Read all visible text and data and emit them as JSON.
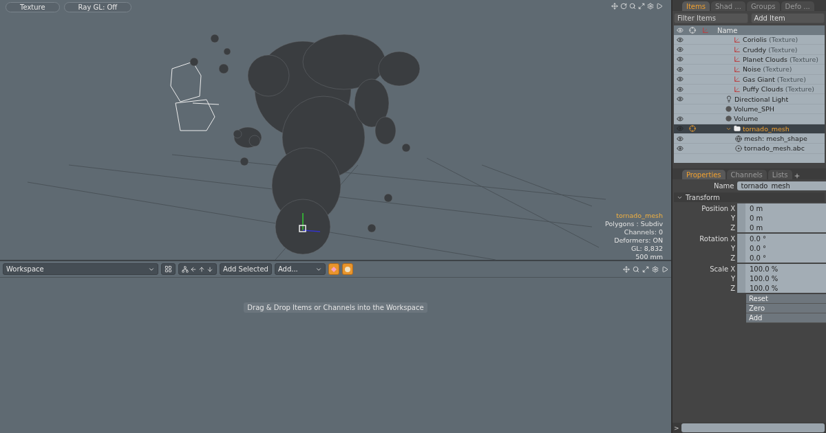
{
  "viewport": {
    "toolbar": [
      "Texture",
      "Ray GL: Off"
    ],
    "info": {
      "title": "tornado_mesh",
      "lines": [
        "Polygons : Subdiv",
        "Channels: 0",
        "Deformers: ON",
        "GL: 8,832",
        "500 mm"
      ]
    }
  },
  "workspace": {
    "dropdown": "Workspace",
    "add_selected": "Add Selected",
    "add_dropdown": "Add...",
    "hint": "Drag & Drop Items or Channels into the Workspace"
  },
  "items_panel": {
    "tabs": [
      {
        "label": "Items",
        "selected": true
      },
      {
        "label": "Shad ...",
        "selected": false
      },
      {
        "label": "Groups",
        "selected": false
      },
      {
        "label": "Defo ...",
        "selected": false
      }
    ],
    "filter": {
      "placeholder": "Filter Items"
    },
    "add_item": "Add Item",
    "name_header": "Name",
    "rows": [
      {
        "name": "Coriolis",
        "suffix": "(Texture)",
        "kind": "texture",
        "visible": true,
        "selected": false
      },
      {
        "name": "Cruddy",
        "suffix": "(Texture)",
        "kind": "texture",
        "visible": true,
        "selected": false
      },
      {
        "name": "Planet Clouds",
        "suffix": "(Texture)",
        "kind": "texture",
        "visible": true,
        "selected": false
      },
      {
        "name": "Noise",
        "suffix": "(Texture)",
        "kind": "texture",
        "visible": true,
        "selected": false
      },
      {
        "name": "Gas Giant",
        "suffix": "(Texture)",
        "kind": "texture",
        "visible": true,
        "selected": false
      },
      {
        "name": "Puffy Clouds",
        "suffix": "(Texture)",
        "kind": "texture",
        "visible": true,
        "selected": false
      },
      {
        "name": "Directional Light",
        "kind": "light",
        "visible": true,
        "selected": false
      },
      {
        "name": "Volume_SPH",
        "kind": "volume",
        "visible": false,
        "selected": false
      },
      {
        "name": "Volume",
        "kind": "volume",
        "visible": true,
        "selected": false
      },
      {
        "name": "tornado_mesh",
        "kind": "group",
        "visible": true,
        "selected": true,
        "expanded": true,
        "children": [
          {
            "name": "mesh: mesh_shape",
            "kind": "mesh",
            "visible": true,
            "selected": false
          },
          {
            "name": "tornado_mesh.abc",
            "kind": "cache",
            "visible": true,
            "selected": false
          }
        ]
      }
    ]
  },
  "properties_panel": {
    "tabs": [
      {
        "label": "Properties",
        "selected": true
      },
      {
        "label": "Channels",
        "selected": false
      },
      {
        "label": "Lists",
        "selected": false
      }
    ],
    "name_label": "Name",
    "name_value": "tornado_mesh",
    "section": {
      "title": "Transform",
      "expanded": true,
      "groups": [
        {
          "label": "Position",
          "rows": [
            {
              "axis": "X",
              "value": "0 m"
            },
            {
              "axis": "Y",
              "value": "0 m"
            },
            {
              "axis": "Z",
              "value": "0 m"
            }
          ]
        },
        {
          "label": "Rotation",
          "rows": [
            {
              "axis": "X",
              "value": "0.0 °"
            },
            {
              "axis": "Y",
              "value": "0.0 °"
            },
            {
              "axis": "Z",
              "value": "0.0 °"
            }
          ]
        },
        {
          "label": "Scale",
          "rows": [
            {
              "axis": "X",
              "value": "100.0 %"
            },
            {
              "axis": "Y",
              "value": "100.0 %"
            },
            {
              "axis": "Z",
              "value": "100.0 %"
            }
          ]
        }
      ]
    },
    "buttons": [
      "Reset",
      "Zero",
      "Add"
    ]
  },
  "command_line": {
    "prompt": ">"
  }
}
